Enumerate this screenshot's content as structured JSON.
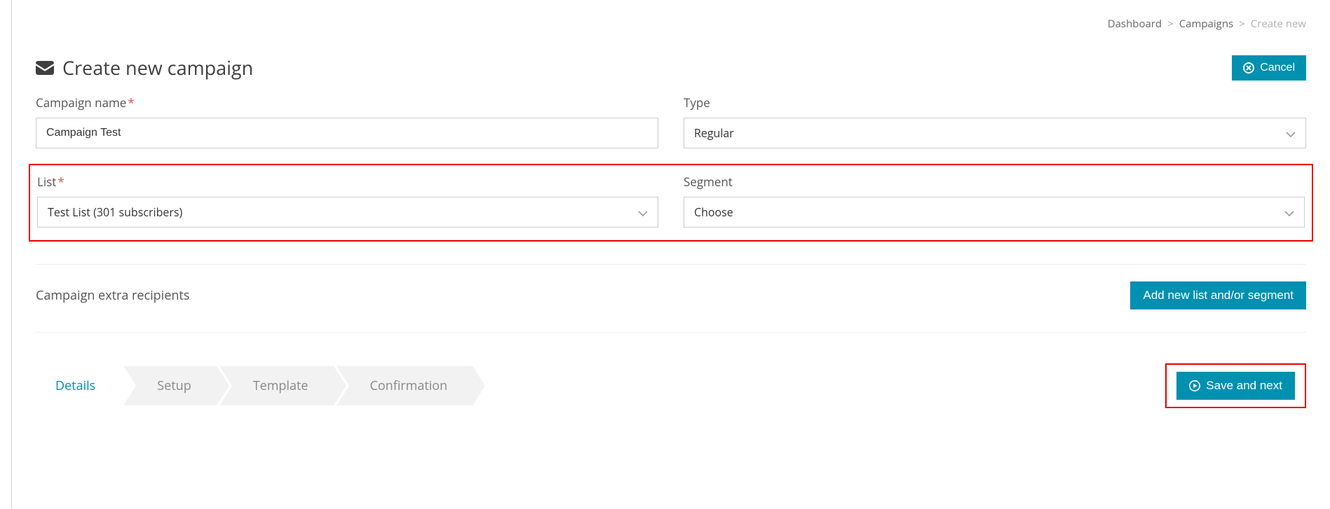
{
  "breadcrumb": {
    "dashboard": "Dashboard",
    "campaigns": "Campaigns",
    "current": "Create new"
  },
  "header": {
    "title": "Create new campaign",
    "cancel_label": "Cancel"
  },
  "form": {
    "campaign_name_label": "Campaign name",
    "campaign_name_value": "Campaign Test",
    "type_label": "Type",
    "type_value": "Regular",
    "list_label": "List",
    "list_value": "Test List (301 subscribers)",
    "segment_label": "Segment",
    "segment_value": "Choose"
  },
  "extra": {
    "label": "Campaign extra recipients",
    "add_label": "Add new list and/or segment"
  },
  "wizard": {
    "steps": [
      "Details",
      "Setup",
      "Template",
      "Confirmation"
    ],
    "save_label": "Save and next"
  }
}
